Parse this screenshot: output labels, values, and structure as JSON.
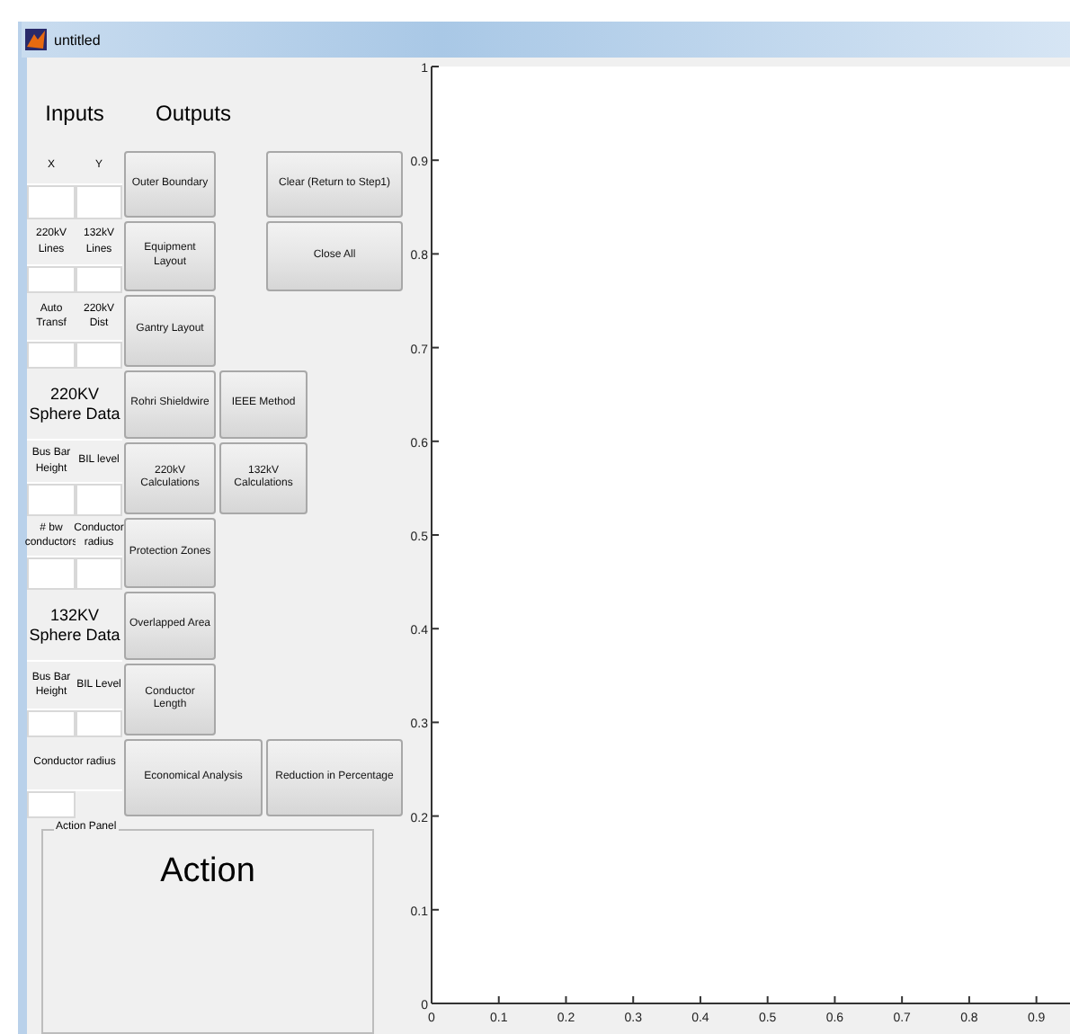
{
  "window": {
    "title": "untitled"
  },
  "headers": {
    "inputs": "Inputs",
    "outputs": "Outputs"
  },
  "input_groups": [
    {
      "kind": "pair",
      "labels": [
        "X",
        "Y"
      ]
    },
    {
      "kind": "pair",
      "labels": [
        "220kV Lines",
        "132kV Lines"
      ]
    },
    {
      "kind": "pair",
      "labels": [
        "Auto Transf",
        "220kV Dist"
      ]
    },
    {
      "kind": "section",
      "title": "220KV Sphere Data"
    },
    {
      "kind": "pair",
      "labels": [
        "Bus Bar Height",
        "BIL level"
      ]
    },
    {
      "kind": "pair",
      "labels": [
        "# bw conductors",
        "Conductor radius"
      ]
    },
    {
      "kind": "section",
      "title": "132KV Sphere Data"
    },
    {
      "kind": "pair",
      "labels": [
        "Bus Bar Height",
        "BIL Level"
      ]
    },
    {
      "kind": "single",
      "labels": [
        "Conductor radius"
      ]
    }
  ],
  "buttons": [
    "Outer Boundary",
    "Clear (Return to Step1)",
    "Equipment Layout",
    "Close All",
    "Gantry Layout",
    "Rohri Shieldwire",
    "IEEE Method",
    "220kV Calculations",
    "132kV Calculations",
    "Protection Zones",
    "Overlapped Area",
    "Conductor Length",
    "Economical Analysis",
    "Reduction in Percentage"
  ],
  "action_panel": {
    "title": "Action Panel",
    "text": "Action"
  },
  "chart_data": {
    "type": "line",
    "xlim": [
      0,
      0.95
    ],
    "ylim": [
      0,
      1
    ],
    "xticks": [
      0,
      0.1,
      0.2,
      0.3,
      0.4,
      0.5,
      0.6,
      0.7,
      0.8,
      0.9
    ],
    "yticks": [
      0,
      0.1,
      0.2,
      0.3,
      0.4,
      0.5,
      0.6,
      0.7,
      0.8,
      0.9,
      1
    ]
  }
}
